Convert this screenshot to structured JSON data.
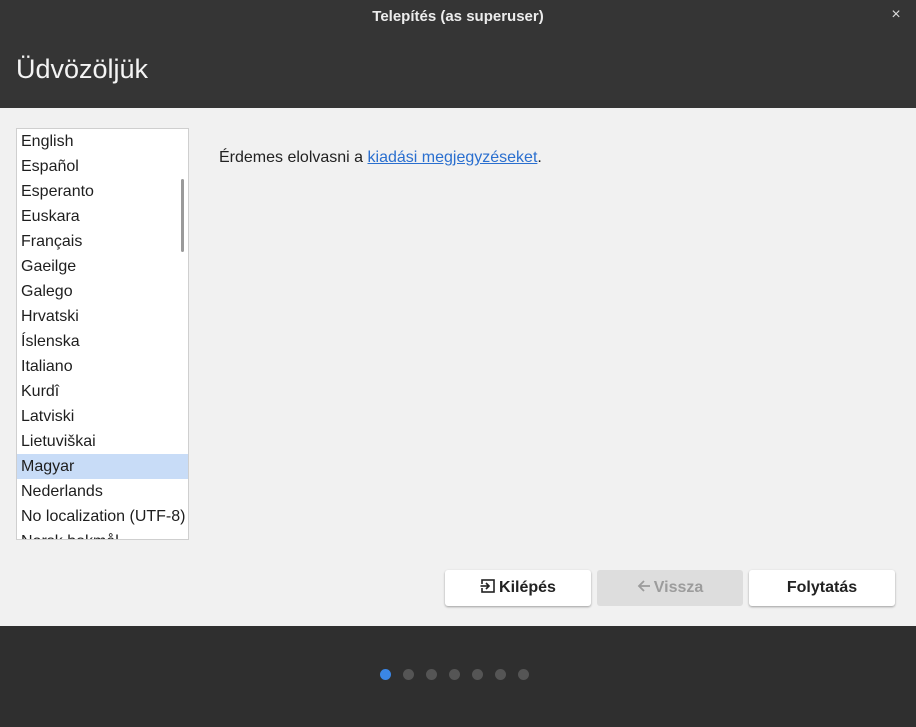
{
  "window": {
    "title": "Telepítés (as superuser)",
    "close_glyph": "×"
  },
  "header": {
    "heading": "Üdvözöljük"
  },
  "languages": {
    "items": [
      "English",
      "Español",
      "Esperanto",
      "Euskara",
      "Français",
      "Gaeilge",
      "Galego",
      "Hrvatski",
      "Íslenska",
      "Italiano",
      "Kurdî",
      "Latviski",
      "Lietuviškai",
      "Magyar",
      "Nederlands",
      "No localization (UTF-8)",
      "Norsk bokmål"
    ],
    "selected": "Magyar"
  },
  "release_notes": {
    "prefix": "Érdemes elolvasni a ",
    "link": "kiadási megjegyzéseket",
    "suffix": "."
  },
  "buttons": {
    "quit": {
      "label": "Kilépés",
      "icon": "logout-icon"
    },
    "back": {
      "label": "Vissza",
      "icon": "arrow-left-icon",
      "disabled": true
    },
    "next": {
      "label": "Folytatás"
    }
  },
  "progress": {
    "total_steps": 7,
    "current_step": 1
  },
  "colors": {
    "accent": "#3a86e6",
    "header_bg": "#353535",
    "content_bg": "#f1f1f1",
    "selection": "#c8dcf7"
  }
}
